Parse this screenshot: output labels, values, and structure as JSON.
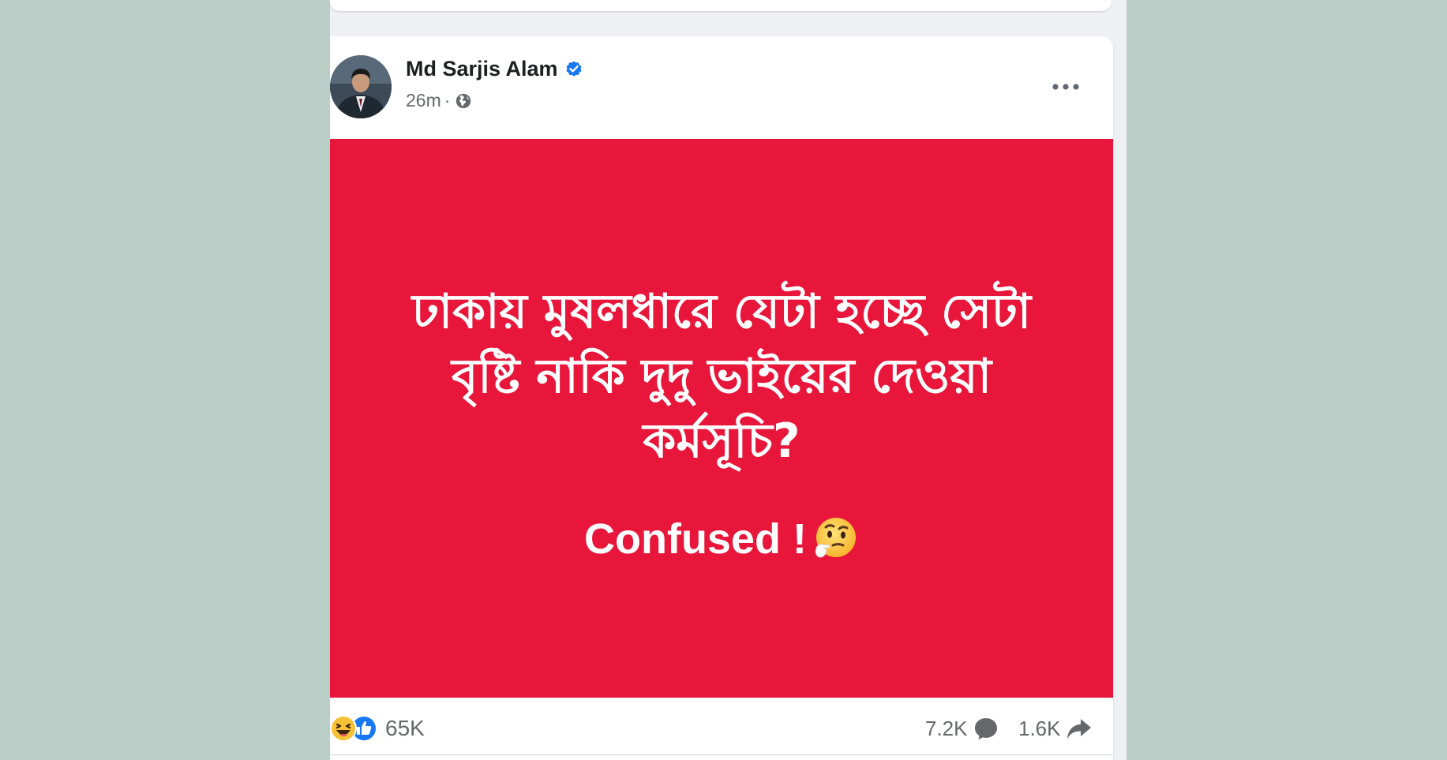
{
  "post": {
    "author": "Md Sarjis Alam",
    "time": "26m",
    "separator": "·",
    "image_text_bangla": "ঢাকায় মুষলধারে যেটা হচ্ছে সেটা বৃষ্টি নাকি দুদু ভাইয়ের দেওয়া কর্মসূচি?",
    "image_text_english": "Confused !",
    "reactions_count": "65K",
    "comments_count": "7.2K",
    "shares_count": "1.6K"
  },
  "icons": {
    "verified": "verified-badge-icon",
    "audience": "globe-icon",
    "more": "more-options-icon",
    "emoji": "thinking-face-icon",
    "reactions": [
      "haha-reaction-icon",
      "like-reaction-icon"
    ],
    "comment": "comment-icon",
    "share": "share-icon"
  },
  "colors": {
    "post_background": "#e8163a",
    "side_background": "#b9cec7",
    "verified_blue": "#1877f2",
    "meta_grey": "#65676b"
  }
}
